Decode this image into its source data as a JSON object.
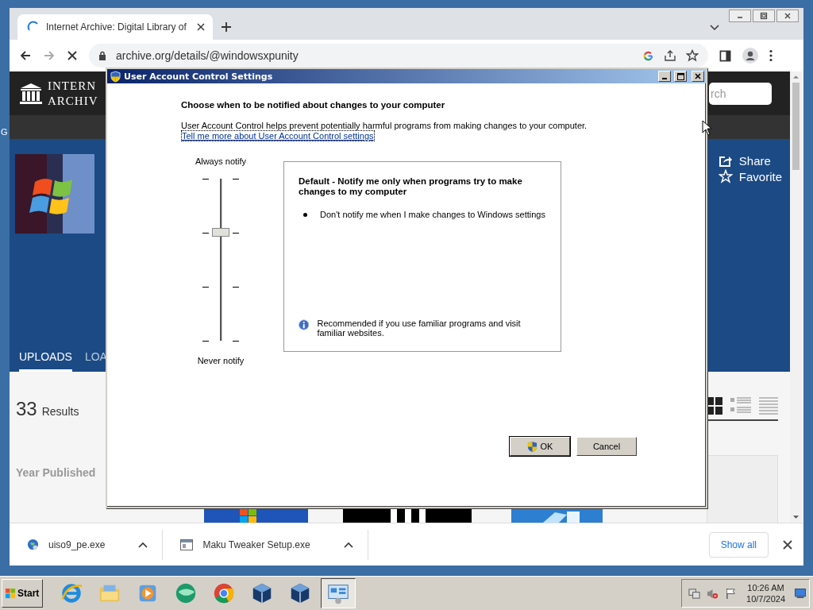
{
  "desktop": {
    "edge_text": "G"
  },
  "browser": {
    "tabs": [
      {
        "title": "Internet Archive: Digital Library of",
        "selected": true,
        "loading": true
      }
    ],
    "address": "archive.org/details/@windowsxpunity"
  },
  "page": {
    "logo_lines": [
      "INTERN",
      "ARCHIV"
    ],
    "search": {
      "placeholder": "rch"
    },
    "actions": [
      {
        "kind": "share",
        "label": "Share"
      },
      {
        "kind": "favorite",
        "label": "Favorite"
      }
    ],
    "tabs": [
      {
        "label": "UPLOADS",
        "selected": true
      },
      {
        "label": "LOA",
        "selected": false
      }
    ],
    "results": {
      "count": "33",
      "label": "Results"
    },
    "filter_heading": "Year Published"
  },
  "downloads": {
    "items": [
      {
        "kind": "globe",
        "name": "uiso9_pe.exe"
      },
      {
        "kind": "window",
        "name": "Maku Tweaker Setup.exe"
      }
    ],
    "show_all": "Show all"
  },
  "dialog": {
    "title": "User Account Control Settings",
    "heading": "Choose when to be notified about changes to your computer",
    "description": "User Account Control helps prevent potentially harmful programs from making changes to your computer.",
    "link": "Tell me more about User Account Control settings",
    "slider": {
      "top_label": "Always notify",
      "bottom_label": "Never notify",
      "level": 0.667
    },
    "info": {
      "title": "Default - Notify me only when programs try to make changes to my computer",
      "bullets": [
        "Don't notify me when I make changes to Windows settings"
      ],
      "note": "Recommended if you use familiar programs and visit familiar websites."
    },
    "buttons": [
      {
        "kind": "shield",
        "label": "OK",
        "default": true
      },
      {
        "kind": "plain",
        "label": "Cancel",
        "default": false
      }
    ]
  },
  "taskbar": {
    "start": "Start",
    "apps": [
      {
        "kind": "ie",
        "active": false
      },
      {
        "kind": "explorer",
        "active": false
      },
      {
        "kind": "media",
        "active": false
      },
      {
        "kind": "orb",
        "active": false
      },
      {
        "kind": "chrome",
        "active": false
      },
      {
        "kind": "vbox",
        "active": false
      },
      {
        "kind": "vbox",
        "active": false
      },
      {
        "kind": "uac",
        "active": true
      }
    ],
    "clock": {
      "time": "10:26 AM",
      "date": "10/7/2024"
    }
  }
}
